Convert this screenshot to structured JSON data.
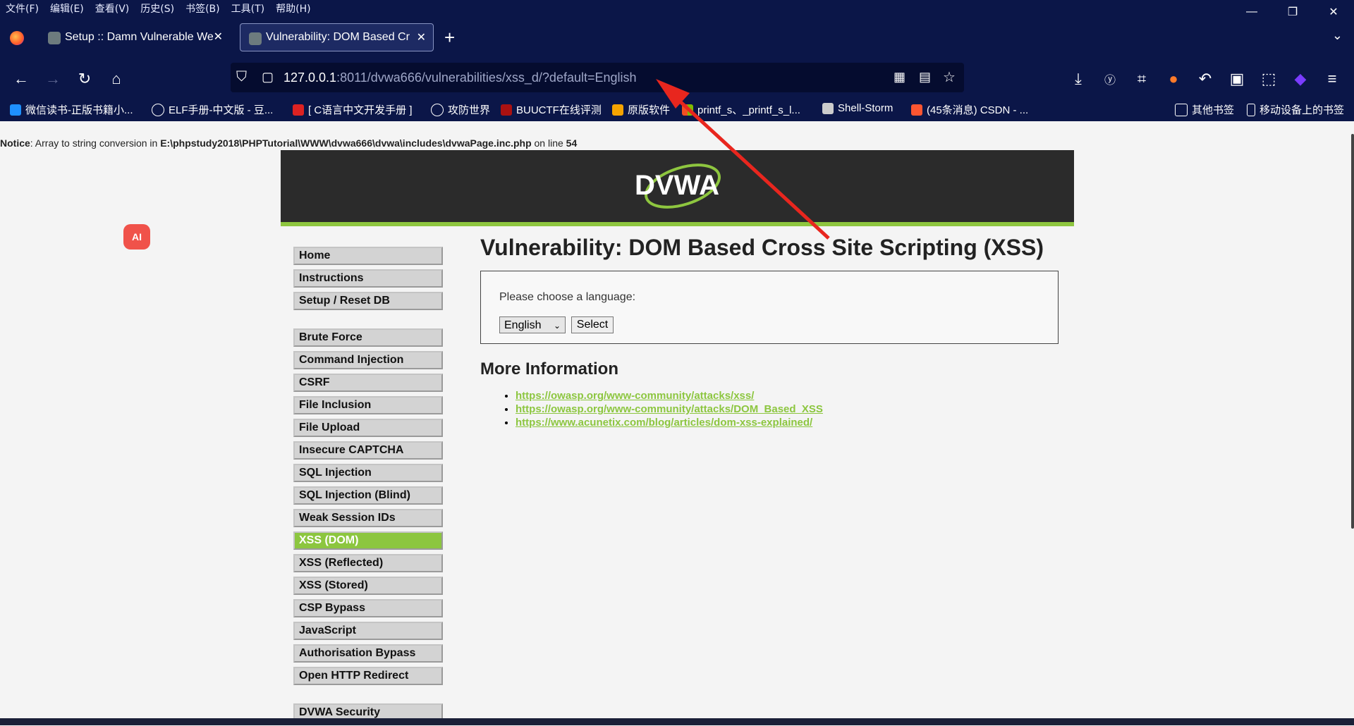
{
  "menubar": {
    "items": [
      "文件(F)",
      "编辑(E)",
      "查看(V)",
      "历史(S)",
      "书签(B)",
      "工具(T)",
      "帮助(H)"
    ]
  },
  "window_controls": {
    "minimize": "—",
    "restore": "❐",
    "close": "✕"
  },
  "tabs": [
    {
      "label": "Setup :: Damn Vulnerable We",
      "close": "✕"
    },
    {
      "label": "Vulnerability: DOM Based Cr",
      "close": "✕"
    }
  ],
  "new_tab": "+",
  "url": {
    "host": "127.0.0.1",
    "rest": ":8011/dvwa666/vulnerabilities/xss_d/?default=English"
  },
  "bookmarks": [
    "微信读书-正版书籍小...",
    "ELF手册-中文版 - 豆...",
    "[ C语言中文开发手册 ]",
    "攻防世界",
    "BUUCTF在线评测",
    "原版软件",
    "printf_s、_printf_s_l...",
    "Shell-Storm",
    "(45条消息) CSDN - ..."
  ],
  "bookmarks_right": [
    "其他书签",
    "移动设备上的书签"
  ],
  "notice": {
    "label": "Notice",
    "text": ": Array to string conversion in ",
    "path": "E:\\phpstudy2018\\PHPTutorial\\WWW\\dvwa666\\dvwa\\includes\\dvwaPage.inc.php",
    "online": " on line ",
    "line": "54"
  },
  "logo_text": "DVWA",
  "ai_badge": "AI",
  "sidebar": {
    "group1": [
      "Home",
      "Instructions",
      "Setup / Reset DB"
    ],
    "group2": [
      "Brute Force",
      "Command Injection",
      "CSRF",
      "File Inclusion",
      "File Upload",
      "Insecure CAPTCHA",
      "SQL Injection",
      "SQL Injection (Blind)",
      "Weak Session IDs",
      "XSS (DOM)",
      "XSS (Reflected)",
      "XSS (Stored)",
      "CSP Bypass",
      "JavaScript",
      "Authorisation Bypass",
      "Open HTTP Redirect"
    ],
    "group3": [
      "DVWA Security"
    ],
    "selected": "XSS (DOM)"
  },
  "main": {
    "title": "Vulnerability: DOM Based Cross Site Scripting (XSS)",
    "choose": "Please choose a language:",
    "select_value": "English",
    "select_button": "Select",
    "more_info": "More Information",
    "links": [
      "https://owasp.org/www-community/attacks/xss/",
      "https://owasp.org/www-community/attacks/DOM_Based_XSS",
      "https://www.acunetix.com/blog/articles/dom-xss-explained/"
    ]
  },
  "colors": {
    "chrome": "#0b1648",
    "accent": "#8cc63f",
    "header": "#2b2b2b",
    "arrow": "#e8261e"
  }
}
